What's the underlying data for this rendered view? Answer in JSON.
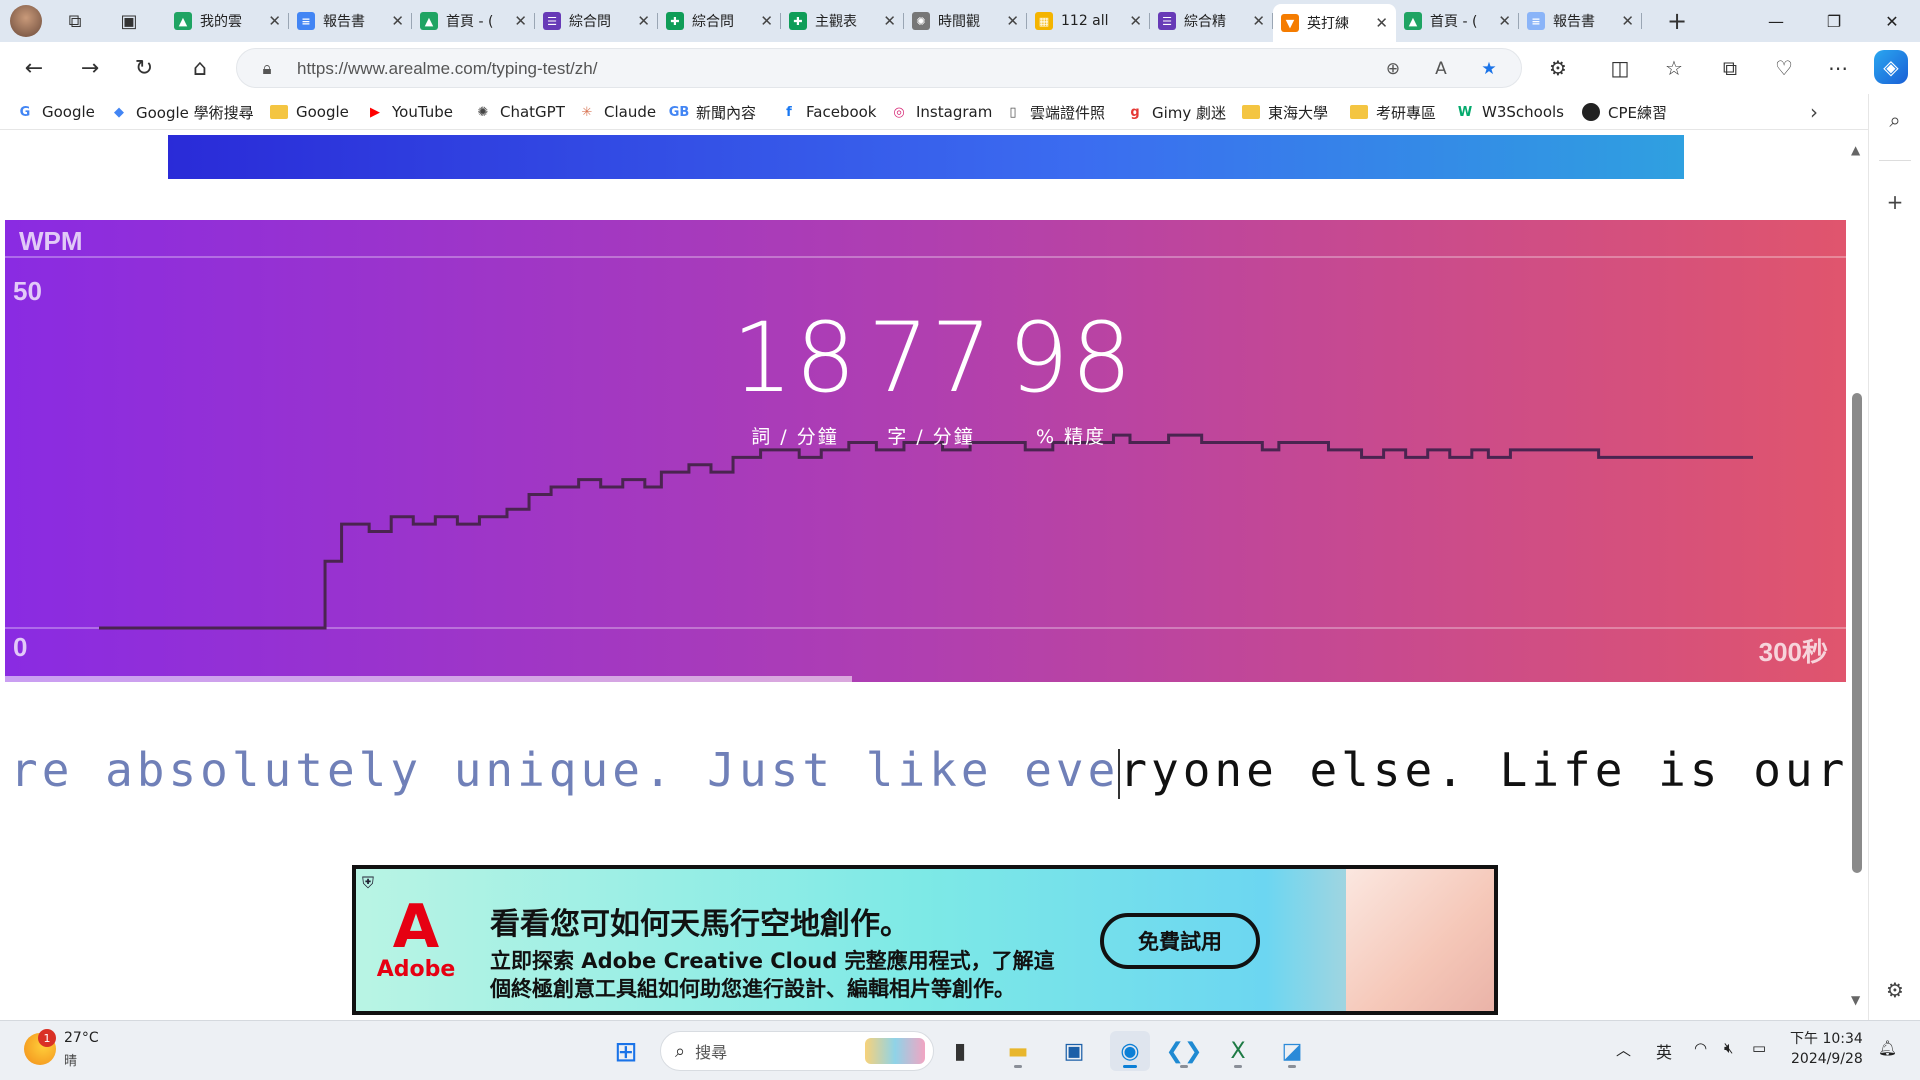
{
  "browser": {
    "tabs": [
      {
        "title": "我的雲",
        "fav": "drive",
        "color": "#1fa463"
      },
      {
        "title": "報告書",
        "fav": "doc",
        "color": "#4285f4"
      },
      {
        "title": "首頁 - (",
        "fav": "drive",
        "color": "#1fa463"
      },
      {
        "title": "綜合問",
        "fav": "form",
        "color": "#673ab7"
      },
      {
        "title": "綜合問",
        "fav": "sheet",
        "color": "#0f9d58"
      },
      {
        "title": "主觀表",
        "fav": "sheet",
        "color": "#0f9d58"
      },
      {
        "title": "時間觀",
        "fav": "openai",
        "color": "#777777"
      },
      {
        "title": "112 all",
        "fav": "classroom",
        "color": "#f4b400"
      },
      {
        "title": "綜合精",
        "fav": "form",
        "color": "#673ab7"
      },
      {
        "title": "英打練",
        "fav": "fox",
        "color": "#f57c00"
      },
      {
        "title": "首頁 - (",
        "fav": "drive",
        "color": "#1fa463"
      },
      {
        "title": "報告書",
        "fav": "doc",
        "color": "#8ab4f8"
      }
    ],
    "active_tab": 9,
    "url": "https://www.arealme.com/typing-test/zh/",
    "bookmarks": [
      {
        "label": "Google",
        "icon": "G",
        "color": "#4285f4"
      },
      {
        "label": "Google 學術搜尋",
        "icon": "◆",
        "color": "#4285f4"
      },
      {
        "label": "Google",
        "icon": "folder",
        "color": "#f4c542"
      },
      {
        "label": "YouTube",
        "icon": "▶",
        "color": "#ff0000"
      },
      {
        "label": "ChatGPT",
        "icon": "✺",
        "color": "#444444"
      },
      {
        "label": "Claude",
        "icon": "✳",
        "color": "#d97757"
      },
      {
        "label": "新聞內容",
        "icon": "GB",
        "color": "#4285f4"
      },
      {
        "label": "Facebook",
        "icon": "f",
        "color": "#1877f2"
      },
      {
        "label": "Instagram",
        "icon": "◎",
        "color": "#d62976"
      },
      {
        "label": "雲端證件照",
        "icon": "page",
        "color": "#555555"
      },
      {
        "label": "Gimy 劇迷",
        "icon": "g",
        "color": "#e53935"
      },
      {
        "label": "東海大學",
        "icon": "folder",
        "color": "#f4c542"
      },
      {
        "label": "考研專區",
        "icon": "folder",
        "color": "#f4c542"
      },
      {
        "label": "W3Schools",
        "icon": "W",
        "color": "#04aa6d"
      },
      {
        "label": "CPE練習",
        "icon": "gh",
        "color": "#222222"
      }
    ]
  },
  "page": {
    "chart_header": "WPM",
    "y_top_label": "50",
    "y_bottom_label": "0",
    "x_end_label": "300秒",
    "stats": [
      {
        "value": "18",
        "label": "詞 / 分鐘"
      },
      {
        "value": "77",
        "label": "字 / 分鐘"
      },
      {
        "value": "98",
        "label": "% 精度"
      }
    ],
    "progress_fraction": 0.46,
    "typing": {
      "typed": "re absolutely unique. Just like eve",
      "remaining": "ryone else. Life is ours to be spent"
    },
    "ad": {
      "brand": "Adobe",
      "headline": "看看您可如何天馬行空地創作。",
      "line1": "立即探索 Adobe Creative Cloud 完整應用程式，了解這",
      "line2": "個終極創意工具組如何助您進行設計、編輯相片等創作。",
      "cta": "免費試用"
    }
  },
  "chart_data": {
    "type": "line",
    "title": "WPM",
    "xlabel": "",
    "ylabel": "WPM",
    "xlim": [
      0,
      300
    ],
    "ylim": [
      0,
      50
    ],
    "x_end_label": "300秒",
    "grid": true,
    "series": [
      {
        "style": "step",
        "points": [
          [
            0,
            0
          ],
          [
            40,
            0
          ],
          [
            41,
            9
          ],
          [
            43,
            9
          ],
          [
            44,
            14
          ],
          [
            48,
            14
          ],
          [
            49,
            13
          ],
          [
            52,
            13
          ],
          [
            53,
            15
          ],
          [
            56,
            15
          ],
          [
            57,
            14
          ],
          [
            60,
            14
          ],
          [
            61,
            15
          ],
          [
            64,
            15
          ],
          [
            65,
            14
          ],
          [
            68,
            14
          ],
          [
            69,
            15
          ],
          [
            73,
            15
          ],
          [
            74,
            16
          ],
          [
            77,
            16
          ],
          [
            78,
            18
          ],
          [
            81,
            18
          ],
          [
            82,
            19
          ],
          [
            86,
            19
          ],
          [
            87,
            20
          ],
          [
            90,
            20
          ],
          [
            91,
            19
          ],
          [
            94,
            19
          ],
          [
            95,
            20
          ],
          [
            98,
            20
          ],
          [
            99,
            19
          ],
          [
            101,
            19
          ],
          [
            102,
            21
          ],
          [
            106,
            21
          ],
          [
            107,
            22
          ],
          [
            110,
            22
          ],
          [
            111,
            21
          ],
          [
            114,
            21
          ],
          [
            115,
            23
          ],
          [
            119,
            23
          ],
          [
            120,
            24
          ],
          [
            126,
            24
          ],
          [
            127,
            23
          ],
          [
            130,
            23
          ],
          [
            131,
            24
          ],
          [
            135,
            24
          ],
          [
            136,
            25
          ],
          [
            140,
            25
          ],
          [
            141,
            24
          ],
          [
            145,
            24
          ],
          [
            146,
            25
          ],
          [
            152,
            25
          ],
          [
            153,
            24
          ],
          [
            157,
            24
          ],
          [
            158,
            25
          ],
          [
            167,
            25
          ],
          [
            168,
            24
          ],
          [
            172,
            24
          ],
          [
            173,
            25
          ],
          [
            183,
            25
          ],
          [
            184,
            26
          ],
          [
            186,
            26
          ],
          [
            187,
            25
          ],
          [
            193,
            25
          ],
          [
            194,
            26
          ],
          [
            199,
            26
          ],
          [
            200,
            25
          ],
          [
            210,
            25
          ],
          [
            211,
            24
          ],
          [
            213,
            24
          ],
          [
            214,
            25
          ],
          [
            222,
            25
          ],
          [
            223,
            24
          ],
          [
            228,
            24
          ],
          [
            229,
            23
          ],
          [
            232,
            23
          ],
          [
            233,
            24
          ],
          [
            236,
            24
          ],
          [
            237,
            23
          ],
          [
            240,
            23
          ],
          [
            241,
            24
          ],
          [
            244,
            24
          ],
          [
            245,
            23
          ],
          [
            248,
            23
          ],
          [
            249,
            24
          ],
          [
            251,
            24
          ],
          [
            252,
            23
          ],
          [
            255,
            23
          ],
          [
            256,
            24
          ],
          [
            271,
            24
          ],
          [
            272,
            23
          ],
          [
            300,
            23
          ]
        ]
      }
    ]
  },
  "taskbar": {
    "weather_temp": "27°C",
    "weather_desc": "晴",
    "weather_badge": "1",
    "search_placeholder": "搜尋",
    "ime": "英",
    "time": "下午 10:34",
    "date": "2024/9/28"
  }
}
